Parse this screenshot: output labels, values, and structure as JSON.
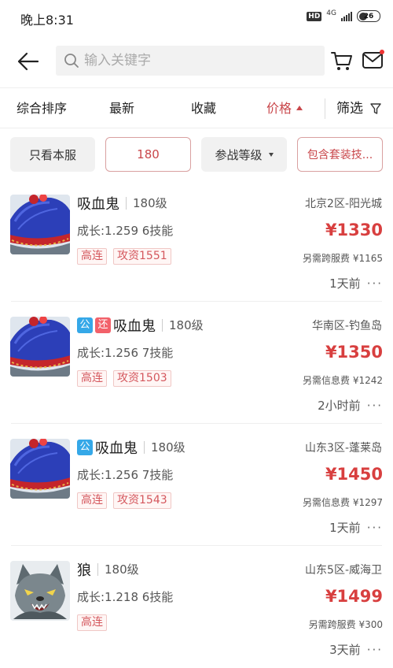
{
  "status": {
    "time": "晚上8:31",
    "hd": "HD",
    "network": "4G",
    "battery": "26"
  },
  "header": {
    "search_placeholder": "输入关键字"
  },
  "sort": {
    "items": [
      "综合排序",
      "最新",
      "收藏",
      "价格"
    ],
    "filter": "筛选"
  },
  "chips": [
    "只看本服",
    "180",
    "参战等级",
    "包含套装技..."
  ],
  "listings": [
    {
      "badges": [],
      "name": "吸血鬼",
      "level": "180级",
      "growth": "成长:1.259 6技能",
      "tags": [
        "高连",
        "攻资1551"
      ],
      "server": "北京2区-阳光城",
      "price": "¥1330",
      "fee": "另需跨服费 ¥1165",
      "time": "1天前",
      "icon": "vampire-pet-icon"
    },
    {
      "badges": [
        "公",
        "还"
      ],
      "name": "吸血鬼",
      "level": "180级",
      "growth": "成长:1.256 7技能",
      "tags": [
        "高连",
        "攻资1503"
      ],
      "server": "华南区-钓鱼岛",
      "price": "¥1350",
      "fee": "另需信息费 ¥1242",
      "time": "2小时前",
      "icon": "vampire-pet-icon"
    },
    {
      "badges": [
        "公"
      ],
      "name": "吸血鬼",
      "level": "180级",
      "growth": "成长:1.256 7技能",
      "tags": [
        "高连",
        "攻资1543"
      ],
      "server": "山东3区-蓬莱岛",
      "price": "¥1450",
      "fee": "另需信息费 ¥1297",
      "time": "1天前",
      "icon": "vampire-pet-icon"
    },
    {
      "badges": [],
      "name": "狼",
      "level": "180级",
      "growth": "成长:1.218 6技能",
      "tags": [
        "高连"
      ],
      "server": "山东5区-威海卫",
      "price": "¥1499",
      "fee": "另需跨服费 ¥300",
      "time": "3天前",
      "icon": "wolf-pet-icon"
    }
  ],
  "colors": {
    "accent": "#c9474b",
    "price": "#d83f3f",
    "badge_public": "#35a8e8",
    "badge_return": "#f2616a"
  }
}
